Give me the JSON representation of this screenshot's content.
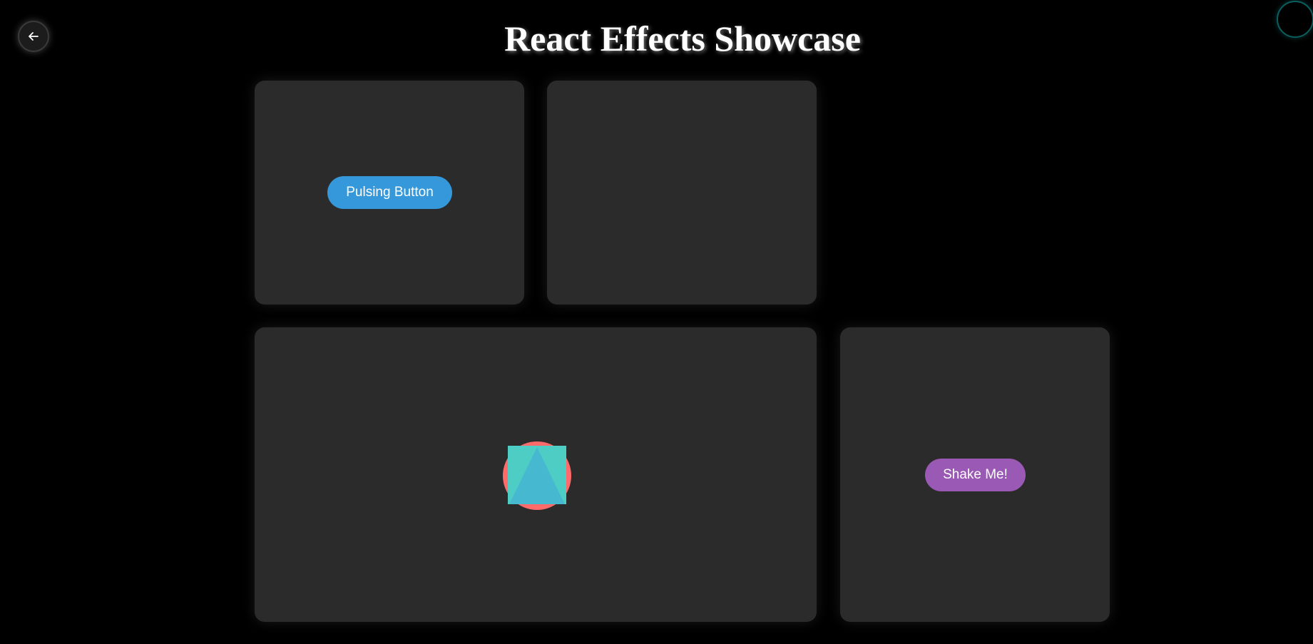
{
  "header": {
    "title": "React Effects Showcase",
    "back_icon": "arrow-left-icon"
  },
  "cards": {
    "pulse": {
      "button_label": "Pulsing Button",
      "button_color": "#3498db"
    },
    "shapes": {
      "circle_color": "#ff6b6b",
      "square_color": "#4ecdc4",
      "triangle_color": "#45b7d1"
    },
    "shake": {
      "button_label": "Shake Me!",
      "button_color": "#9b59b6"
    }
  },
  "colors": {
    "background": "#000000",
    "card": "#2b2b2b",
    "cursor_ring": "#0b5f5f"
  }
}
